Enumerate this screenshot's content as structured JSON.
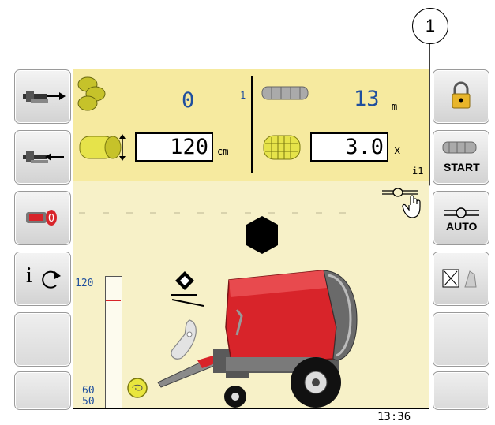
{
  "callout": {
    "number": "1"
  },
  "left_buttons": [
    {
      "icon": "tractor-arrow-right-icon"
    },
    {
      "icon": "tractor-arrow-left-icon"
    },
    {
      "icon": "counter-reset-icon"
    },
    {
      "icon": "info-refresh-icon",
      "label": "i"
    },
    {
      "icon": ""
    },
    {
      "icon": ""
    }
  ],
  "right_buttons": [
    {
      "icon": "padlock-icon"
    },
    {
      "icon": "net-roll-icon",
      "label": "START"
    },
    {
      "icon": "knot-icon",
      "label": "AUTO"
    },
    {
      "icon": "sensor-cancel-icon"
    },
    {
      "icon": ""
    },
    {
      "icon": ""
    }
  ],
  "top": {
    "bale_count": "0",
    "bale_count_superscript": "1",
    "net_length": "13",
    "net_length_unit": "m",
    "bale_diameter": "120",
    "bale_diameter_unit": "cm",
    "net_wraps": "3.0",
    "net_wraps_unit": "x",
    "counter_index": "i1"
  },
  "scale": {
    "top": "120",
    "low": "60",
    "bottom": "50",
    "fill_fraction": 0.0
  },
  "clock": "13:36",
  "colors": {
    "panel": "#f7f1c8",
    "panel_top": "#f6ea9f",
    "value": "#1f4f9e",
    "baler_red": "#d8242a"
  }
}
